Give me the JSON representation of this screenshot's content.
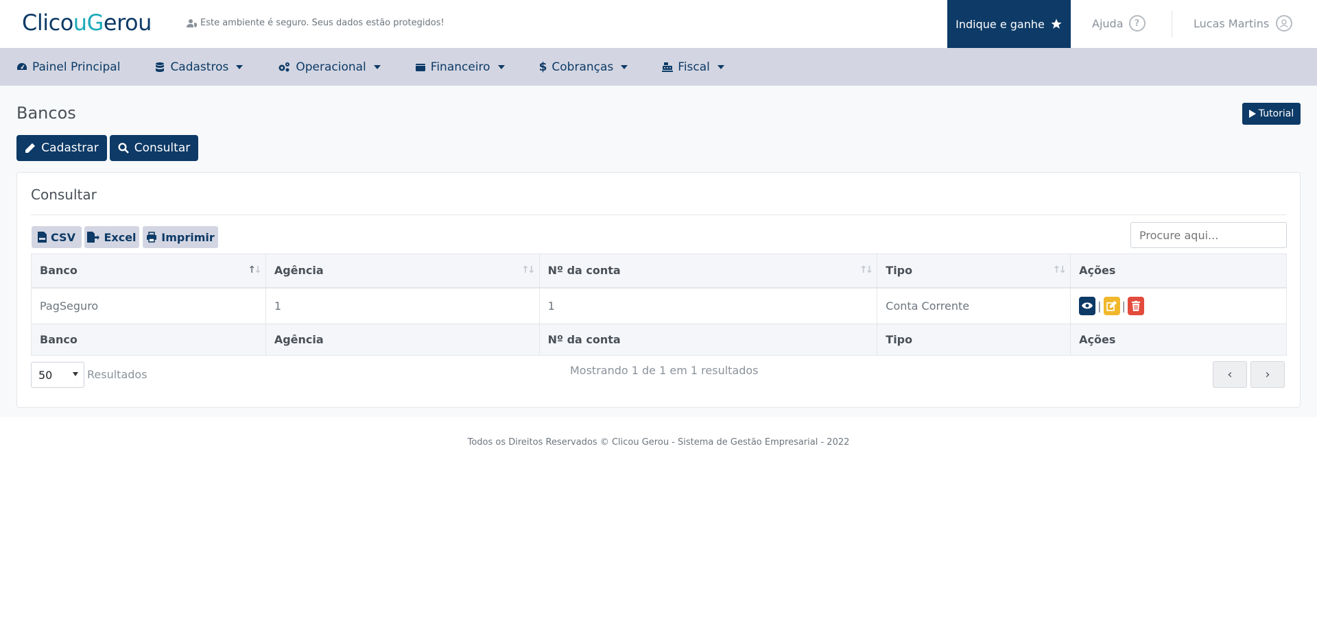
{
  "brand": {
    "part1": "Clico",
    "part2": "u",
    "part3": "G",
    "part4": "erou"
  },
  "header": {
    "secure_text": "Este ambiente é seguro. Seus dados estão protegidos!",
    "indique_label": "Indique e ganhe",
    "help_label": "Ajuda",
    "user_name": "Lucas Martins"
  },
  "nav": {
    "items": [
      {
        "label": "Painel Principal",
        "icon": "dashboard-icon"
      },
      {
        "label": "Cadastros",
        "icon": "database-icon"
      },
      {
        "label": "Operacional",
        "icon": "gears-icon"
      },
      {
        "label": "Financeiro",
        "icon": "wallet-icon"
      },
      {
        "label": "Cobranças",
        "icon": "dollar-icon"
      },
      {
        "label": "Fiscal",
        "icon": "cash-register-icon"
      }
    ]
  },
  "page": {
    "title": "Bancos",
    "tutorial_label": "Tutorial",
    "register_label": "Cadastrar",
    "query_label": "Consultar"
  },
  "card": {
    "title": "Consultar",
    "export": {
      "csv": "CSV",
      "excel": "Excel",
      "print": "Imprimir"
    },
    "search_placeholder": "Procure aqui..."
  },
  "table": {
    "columns": [
      "Banco",
      "Agência",
      "Nº da conta",
      "Tipo",
      "Ações"
    ],
    "rows": [
      {
        "banco": "PagSeguro",
        "agencia": "1",
        "conta": "1",
        "tipo": "Conta Corrente"
      }
    ]
  },
  "pagination": {
    "per_page": "50",
    "results_label": "Resultados",
    "showing": "Mostrando 1 de 1 em 1 resultados",
    "prev": "‹",
    "next": "›"
  },
  "footer": {
    "text": "Todos os Direitos Reservados © Clicou Gerou - Sistema de Gestão Empresarial - 2022"
  },
  "colors": {
    "primary": "#0d3a66",
    "nav_bg": "#d3d6e2",
    "accent": "#1aa9b8",
    "edit": "#f1b82d",
    "delete": "#e34b3d"
  }
}
